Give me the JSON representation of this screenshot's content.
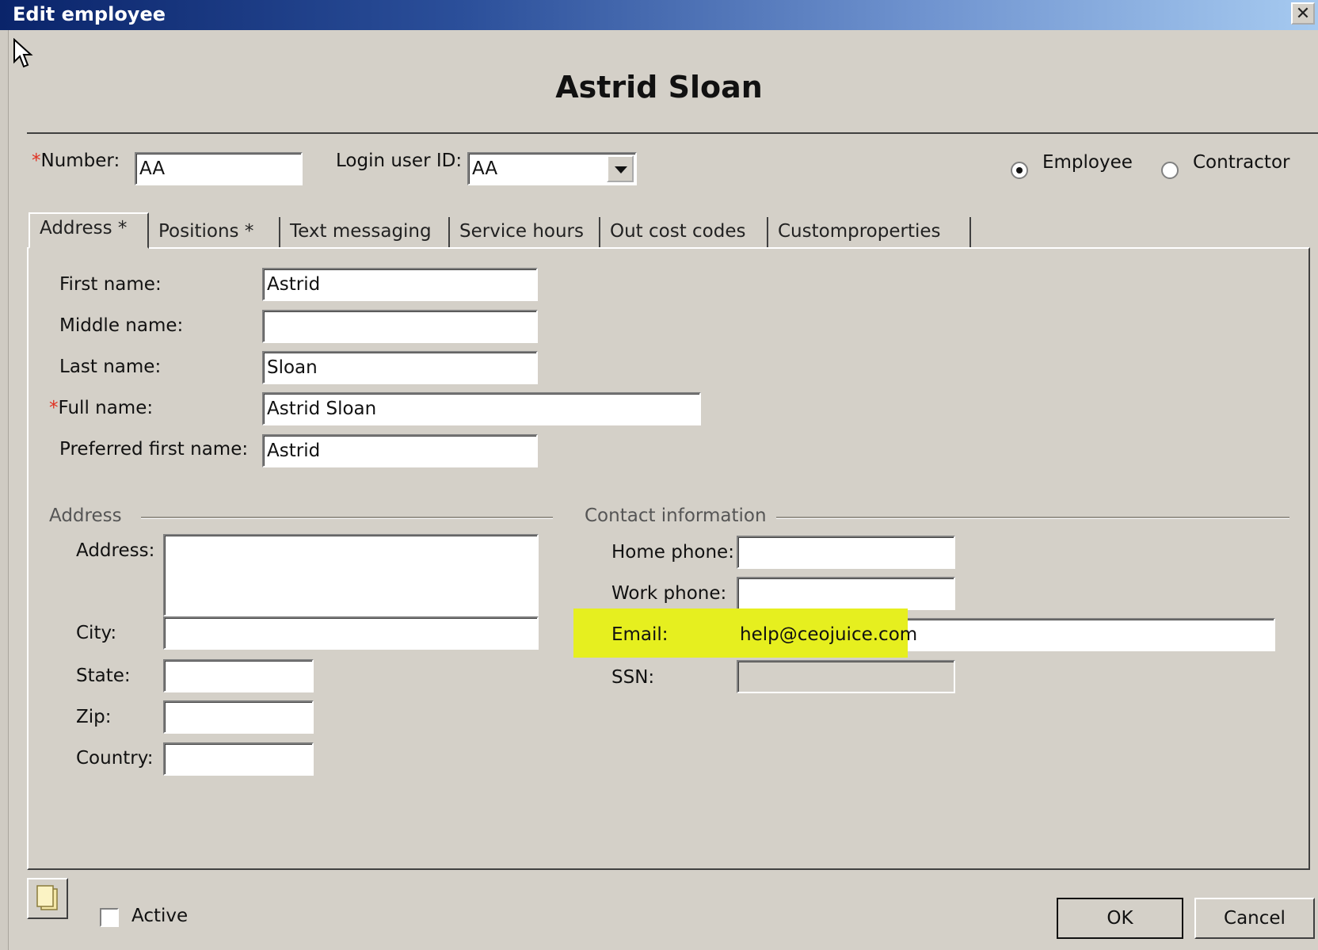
{
  "window": {
    "title": "Edit employee",
    "close_glyph": "✕"
  },
  "header": {
    "name": "Astrid Sloan"
  },
  "top": {
    "number_label": "Number:",
    "number_value": "AA",
    "login_label": "Login user ID:",
    "login_value": "AA",
    "radio_employee": "Employee",
    "radio_contractor": "Contractor",
    "selected": "Employee"
  },
  "tabs": [
    "Address *",
    "Positions *",
    "Text messaging",
    "Service hours",
    "Out cost codes",
    "Customproperties"
  ],
  "name_fields": {
    "first_label": "First name:",
    "first_value": "Astrid",
    "middle_label": "Middle name:",
    "middle_value": "",
    "last_label": "Last name:",
    "last_value": "Sloan",
    "full_label": "Full name:",
    "full_value": "Astrid Sloan",
    "preferred_label": "Preferred first name:",
    "preferred_value": "Astrid"
  },
  "address": {
    "group_title": "Address",
    "address_label": "Address:",
    "address_value": "",
    "city_label": "City:",
    "city_value": "",
    "state_label": "State:",
    "state_value": "",
    "zip_label": "Zip:",
    "zip_value": "",
    "country_label": "Country:",
    "country_value": ""
  },
  "contact": {
    "group_title": "Contact information",
    "home_label": "Home phone:",
    "home_value": "",
    "work_label": "Work phone:",
    "work_value": "",
    "email_label": "Email:",
    "email_value": "help@ceojuice.com",
    "ssn_label": "SSN:",
    "ssn_value": "",
    "highlight_color": "#e6ef1f"
  },
  "footer": {
    "active_label": "Active",
    "active_checked": false,
    "ok_label": "OK",
    "cancel_label": "Cancel"
  },
  "icons": [
    "cursor-icon",
    "close-icon",
    "dropdown-arrow-icon",
    "notes-icon"
  ]
}
